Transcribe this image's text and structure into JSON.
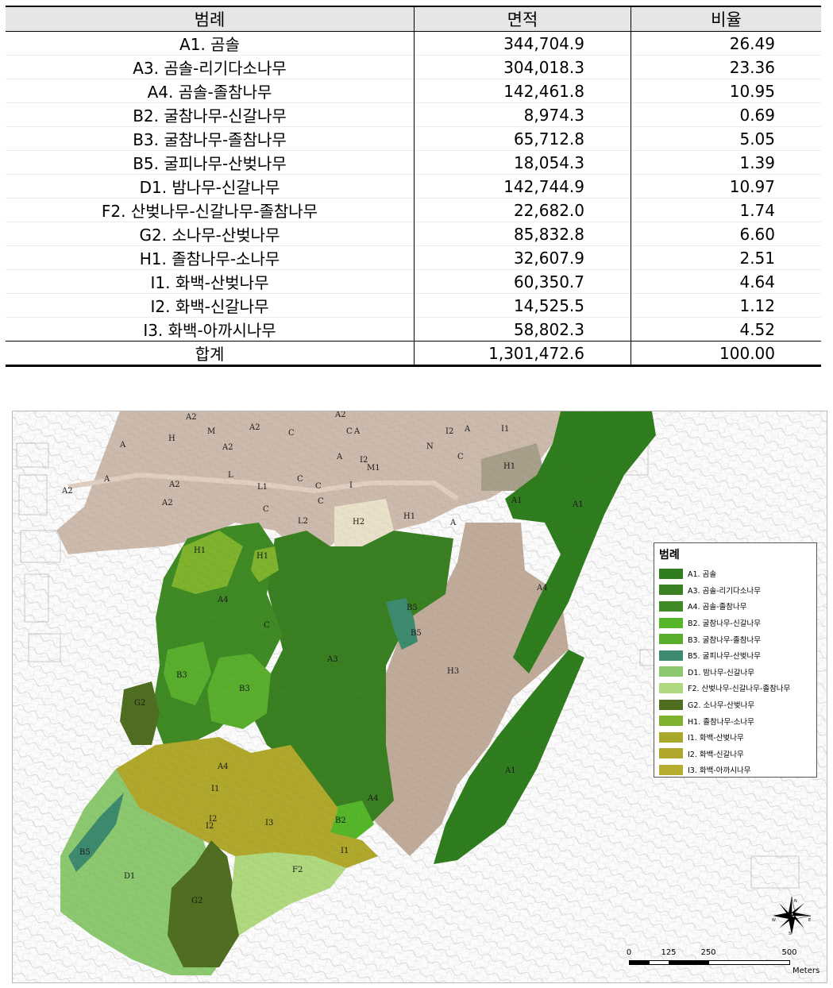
{
  "table": {
    "headers": [
      "범례",
      "면적",
      "비율"
    ],
    "rows": [
      {
        "legend": "A1. 곰솔",
        "area": "344,704.9",
        "ratio": "26.49"
      },
      {
        "legend": "A3. 곰솔-리기다소나무",
        "area": "304,018.3",
        "ratio": "23.36"
      },
      {
        "legend": "A4. 곰솔-졸참나무",
        "area": "142,461.8",
        "ratio": "10.95"
      },
      {
        "legend": "B2. 굴참나무-신갈나무",
        "area": "8,974.3",
        "ratio": "0.69"
      },
      {
        "legend": "B3. 굴참나무-졸참나무",
        "area": "65,712.8",
        "ratio": "5.05"
      },
      {
        "legend": "B5. 굴피나무-산벚나무",
        "area": "18,054.3",
        "ratio": "1.39"
      },
      {
        "legend": "D1. 밤나무-신갈나무",
        "area": "142,744.9",
        "ratio": "10.97"
      },
      {
        "legend": "F2. 산벚나무-신갈나무-졸참나무",
        "area": "22,682.0",
        "ratio": "1.74"
      },
      {
        "legend": "G2. 소나무-산벚나무",
        "area": "85,832.8",
        "ratio": "6.60"
      },
      {
        "legend": "H1. 졸참나무-소나무",
        "area": "32,607.9",
        "ratio": "2.51"
      },
      {
        "legend": "I1. 화백-산벚나무",
        "area": "60,350.7",
        "ratio": "4.64"
      },
      {
        "legend": "I2. 화백-신갈나무",
        "area": "14,525.5",
        "ratio": "1.12"
      },
      {
        "legend": "I3. 화백-아까시나무",
        "area": "58,802.3",
        "ratio": "4.52"
      }
    ],
    "total": {
      "legend": "합계",
      "area": "1,301,472.6",
      "ratio": "100.00"
    }
  },
  "map": {
    "legend": {
      "title": "범례",
      "items": [
        {
          "label": "A1. 곰솔",
          "color": "#2f7d1e"
        },
        {
          "label": "A3. 곰솔-리기다소나무",
          "color": "#3a7f22"
        },
        {
          "label": "A4. 곰솔-졸참나무",
          "color": "#3f8a25"
        },
        {
          "label": "B2. 굴참나무-신갈나무",
          "color": "#55b62a"
        },
        {
          "label": "B3. 굴참나무-졸참나무",
          "color": "#5aae2e"
        },
        {
          "label": "B5. 굴피나무-산벚나무",
          "color": "#3d8a6f"
        },
        {
          "label": "D1. 밤나무-신갈나무",
          "color": "#8cc870"
        },
        {
          "label": "F2. 산벚나무-신갈나무-졸참나무",
          "color": "#b0d87e"
        },
        {
          "label": "G2. 소나무-산벚나무",
          "color": "#4f6e22"
        },
        {
          "label": "H1. 졸참나무-소나무",
          "color": "#7fb22d"
        },
        {
          "label": "I1. 화백-산벚나무",
          "color": "#a8a82a"
        },
        {
          "label": "I2. 화백-신갈나무",
          "color": "#b0a82c"
        },
        {
          "label": "I3. 화백-아까시나무",
          "color": "#b4ad30"
        }
      ]
    },
    "zone_labels": [
      "A1",
      "A1",
      "A1",
      "A3",
      "A4",
      "A4",
      "A4",
      "A4",
      "B2",
      "B3",
      "B3",
      "B5",
      "B5",
      "B5",
      "D1",
      "F2",
      "G2",
      "G2",
      "H1",
      "H1",
      "H1",
      "H1",
      "H2",
      "H3",
      "I1",
      "I1",
      "I2",
      "I2",
      "I3",
      "A2",
      "A2",
      "A2",
      "A2",
      "A2",
      "A2",
      "A2",
      "A",
      "A",
      "A",
      "A",
      "A",
      "A",
      "C",
      "C",
      "C",
      "C",
      "C",
      "C",
      "C",
      "H",
      "L",
      "L1",
      "L2",
      "M",
      "M1",
      "N",
      "I",
      "I1",
      "I2",
      "I2",
      "C"
    ],
    "scale": {
      "ticks": [
        "0",
        "125",
        "250",
        "500"
      ],
      "units": "Meters"
    },
    "compass": {
      "n": "N",
      "s": "S",
      "e": "E",
      "w": "W"
    }
  }
}
